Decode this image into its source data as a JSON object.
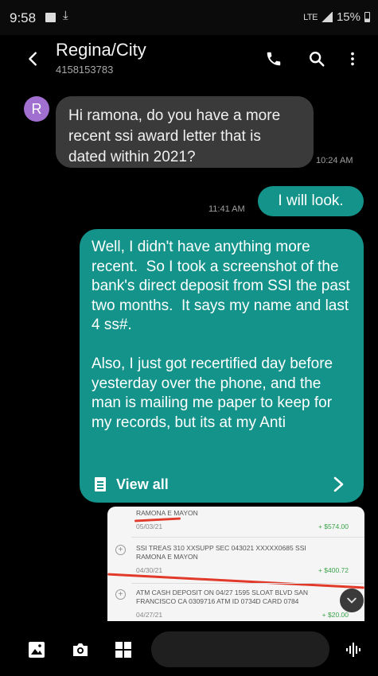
{
  "status_bar": {
    "time": "9:58",
    "lte": "LTE",
    "battery": "15%"
  },
  "header": {
    "contact_name": "Regina/City",
    "contact_number": "4158153783"
  },
  "avatar_letter": "R",
  "messages": {
    "incoming_1": {
      "text": "Hi ramona, do you have a more recent ssi award letter that is dated within 2021?",
      "time": "10:24 AM"
    },
    "outgoing_1": {
      "text": "I will look.",
      "time": "11:41 AM"
    },
    "outgoing_2": {
      "text": "Well, I didn't have anything more recent.  So I took a screenshot of the bank's direct deposit from SSI the past two months.  It says my name and last 4 ss#.\n\nAlso, I just got recertified day before yesterday over the phone, and the man is mailing me paper to keep for my records, but its at my Anti",
      "view_all_label": "View all"
    }
  },
  "screenshot_image": {
    "transactions": [
      {
        "desc": "RAMONA E MAYON",
        "date": "05/03/21",
        "amount": "+ $574.00"
      },
      {
        "desc": "SSI TREAS 310 XXSUPP SEC 043021 XXXXX0685 SSI\nRAMONA E MAYON",
        "date": "04/30/21",
        "amount": "+ $400.72"
      },
      {
        "desc": "ATM CASH DEPOSIT ON 04/27 1595 SLOAT BLVD SAN\nFRANCISCO CA 0309716 ATM ID 0734D CARD 0784",
        "date": "04/27/21",
        "amount": "+ $20.00"
      }
    ]
  },
  "colors": {
    "outgoing_bubble": "#13938a",
    "incoming_bubble": "#3a3a3a",
    "avatar": "#a16fd0"
  },
  "icons": [
    "back-arrow-icon",
    "phone-icon",
    "search-icon",
    "more-vert-icon",
    "document-icon",
    "chevron-right-icon",
    "gallery-icon",
    "camera-icon",
    "apps-grid-icon",
    "voice-icon",
    "chevron-down-icon"
  ]
}
